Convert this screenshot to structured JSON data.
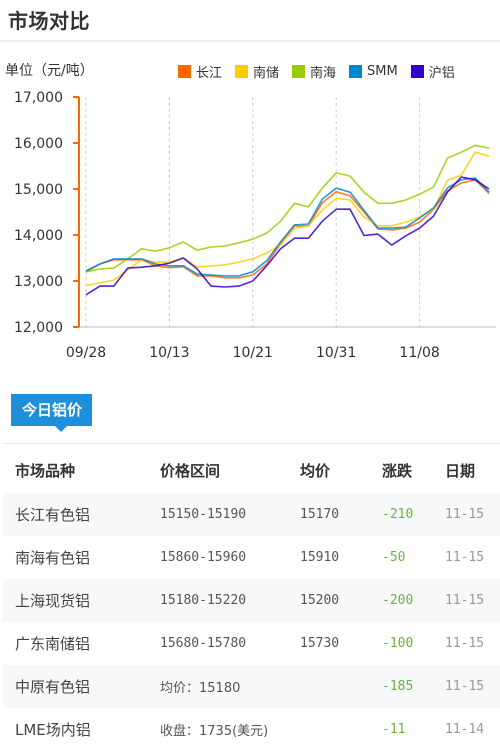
{
  "header": {
    "title": "市场对比"
  },
  "chart_data": {
    "type": "line",
    "title": "市场对比",
    "ylabel": "单位（元/吨）",
    "xlabel": "",
    "ylim": [
      12000,
      17000
    ],
    "yticks": [
      "12,000",
      "13,000",
      "14,000",
      "15,000",
      "16,000",
      "17,000"
    ],
    "ytick_values": [
      12000,
      13000,
      14000,
      15000,
      16000,
      17000
    ],
    "xtick_labels": [
      "09/28",
      "10/13",
      "10/21",
      "10/31",
      "11/08"
    ],
    "xtick_indices": [
      0,
      6,
      12,
      18,
      24
    ],
    "grid": "vertical-dashed",
    "legend_position": "top-right",
    "n_points": 30,
    "series": [
      {
        "name": "长江",
        "color": "#ff6600",
        "values": [
          13200,
          13370,
          13460,
          13460,
          13460,
          13330,
          13290,
          13310,
          13110,
          13110,
          13070,
          13070,
          13130,
          13370,
          13810,
          14200,
          14200,
          14700,
          14940,
          14850,
          14500,
          14130,
          14110,
          14150,
          14280,
          14550,
          14960,
          15130,
          15200,
          14900
        ]
      },
      {
        "name": "南储",
        "color": "#ffcc00",
        "values": [
          12900,
          12960,
          13020,
          13240,
          13460,
          13410,
          13410,
          13500,
          13300,
          13330,
          13350,
          13410,
          13480,
          13610,
          13780,
          14150,
          14200,
          14540,
          14800,
          14760,
          14390,
          14200,
          14200,
          14280,
          14390,
          14560,
          15190,
          15300,
          15800,
          15710
        ]
      },
      {
        "name": "南海",
        "color": "#99cc00",
        "values": [
          13200,
          13260,
          13280,
          13480,
          13700,
          13650,
          13720,
          13850,
          13670,
          13740,
          13760,
          13830,
          13910,
          14040,
          14300,
          14690,
          14610,
          15020,
          15350,
          15280,
          14930,
          14690,
          14690,
          14760,
          14890,
          15040,
          15670,
          15800,
          15950,
          15890
        ]
      },
      {
        "name": "SMM",
        "color": "#0088cc",
        "values": [
          13220,
          13370,
          13480,
          13480,
          13480,
          13370,
          13330,
          13330,
          13150,
          13130,
          13110,
          13110,
          13200,
          13440,
          13850,
          14220,
          14240,
          14780,
          15020,
          14930,
          14540,
          14150,
          14150,
          14170,
          14370,
          14590,
          15020,
          15200,
          15240,
          14930
        ]
      },
      {
        "name": "沪铝",
        "color": "#3300cc",
        "values": [
          12700,
          12890,
          12890,
          13280,
          13300,
          13330,
          13390,
          13500,
          13260,
          12890,
          12870,
          12890,
          13000,
          13330,
          13700,
          13930,
          13930,
          14300,
          14560,
          14560,
          13990,
          14020,
          13780,
          13980,
          14150,
          14410,
          14930,
          15260,
          15200,
          15000
        ]
      }
    ]
  },
  "price_tab": {
    "label": "今日铝价"
  },
  "table": {
    "headers": [
      "市场品种",
      "价格区间",
      "均价",
      "涨跌",
      "日期"
    ],
    "rows": [
      {
        "name": "长江有色铝",
        "range": "15150-15190",
        "avg": "15170",
        "change": "-210",
        "date": "11-15"
      },
      {
        "name": "南海有色铝",
        "range": "15860-15960",
        "avg": "15910",
        "change": "-50",
        "date": "11-15"
      },
      {
        "name": "上海现货铝",
        "range": "15180-15220",
        "avg": "15200",
        "change": "-200",
        "date": "11-15"
      },
      {
        "name": "广东南储铝",
        "range": "15680-15780",
        "avg": "15730",
        "change": "-100",
        "date": "11-15"
      },
      {
        "name": "中原有色铝",
        "range": "均价：15180",
        "avg": "",
        "change": "-185",
        "date": "11-15"
      },
      {
        "name": "LME场内铝",
        "range": "收盘：1735(美元)",
        "avg": "",
        "change": "-11",
        "date": "11-14"
      }
    ]
  },
  "colors": {
    "axis": "#ff6600",
    "tab": "#1e8fdb",
    "change_negative": "#6cb33e",
    "date": "#999999"
  }
}
